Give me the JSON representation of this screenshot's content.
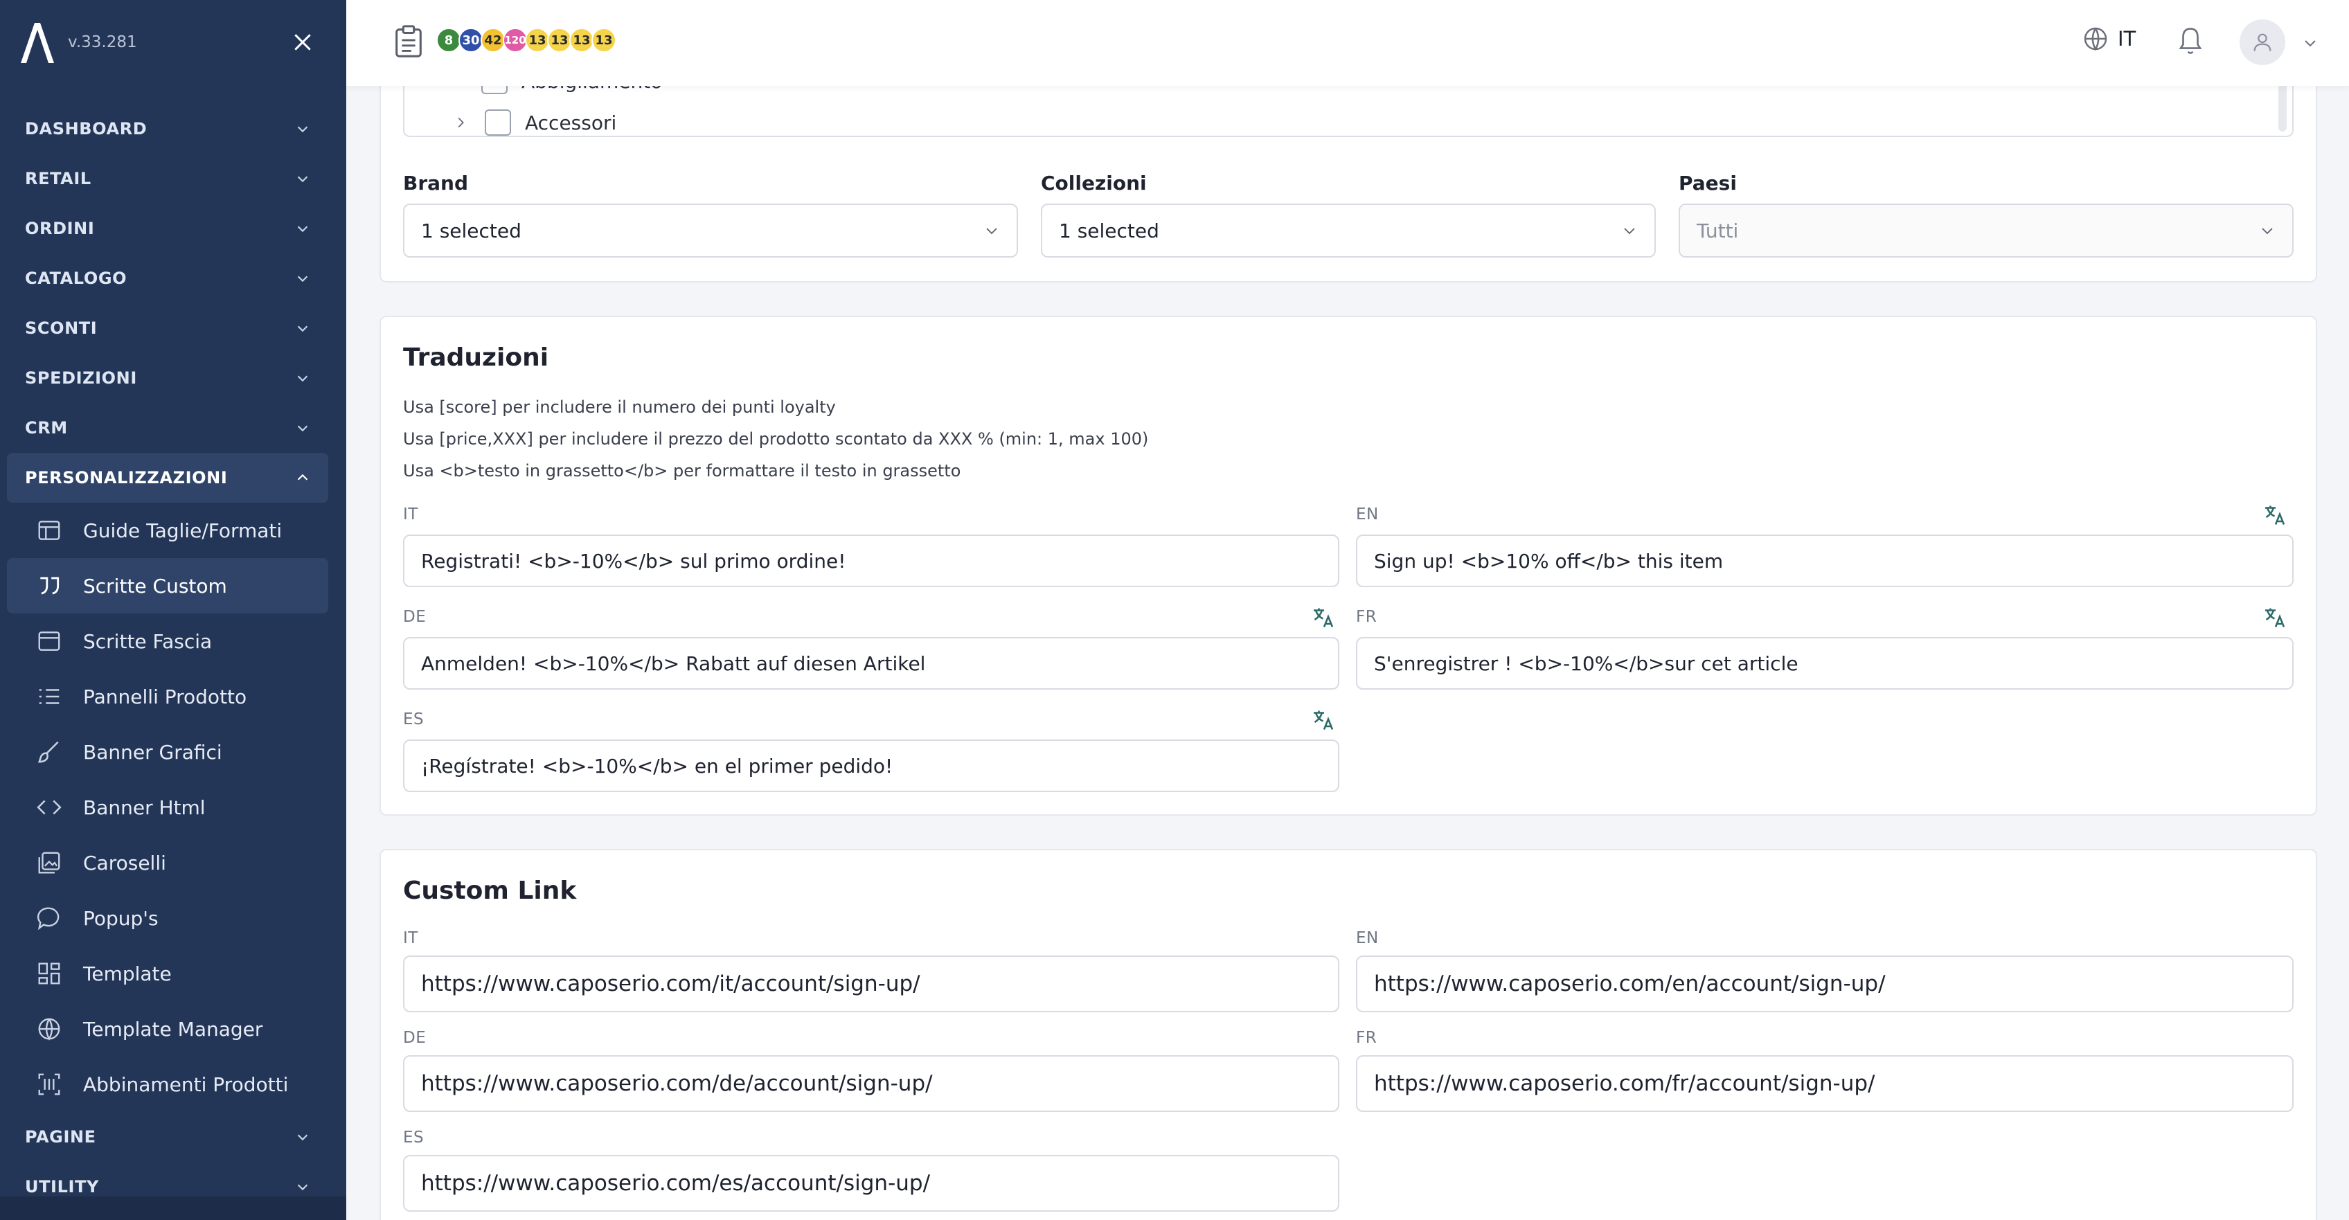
{
  "app": {
    "version": "v.33.281"
  },
  "sidebar": {
    "groups_top": [
      {
        "label": "DASHBOARD"
      },
      {
        "label": "RETAIL"
      },
      {
        "label": "ORDINI"
      },
      {
        "label": "CATALOGO"
      },
      {
        "label": "SCONTI"
      },
      {
        "label": "SPEDIZIONI"
      },
      {
        "label": "CRM"
      }
    ],
    "open_group": {
      "label": "PERSONALIZZAZIONI"
    },
    "sub_items": [
      {
        "label": "Guide Taglie/Formati",
        "icon": "table-icon"
      },
      {
        "label": "Scritte Custom",
        "icon": "quote-icon"
      },
      {
        "label": "Scritte Fascia",
        "icon": "banner-strip-icon"
      },
      {
        "label": "Pannelli Prodotto",
        "icon": "list-icon"
      },
      {
        "label": "Banner Grafici",
        "icon": "brush-icon"
      },
      {
        "label": "Banner Html",
        "icon": "code-icon"
      },
      {
        "label": "Caroselli",
        "icon": "images-icon"
      },
      {
        "label": "Popup's",
        "icon": "chat-bubble-icon"
      },
      {
        "label": "Template",
        "icon": "grid-icon"
      },
      {
        "label": "Template Manager",
        "icon": "globe-icon"
      },
      {
        "label": "Abbinamenti Prodotti",
        "icon": "scan-icon"
      }
    ],
    "groups_bottom": [
      {
        "label": "PAGINE"
      },
      {
        "label": "UTILITY"
      }
    ]
  },
  "topbar": {
    "badges": [
      {
        "value": "8",
        "color": "#3c8a3e"
      },
      {
        "value": "30",
        "color": "#2f4fa8"
      },
      {
        "value": "42",
        "color": "#f2c230"
      },
      {
        "value": "120",
        "color": "#e05aa6"
      },
      {
        "value": "13",
        "color": "#f6d44a"
      },
      {
        "value": "13",
        "color": "#f6d44a"
      },
      {
        "value": "13",
        "color": "#f6d44a"
      },
      {
        "value": "13",
        "color": "#f6d44a"
      }
    ],
    "language": "IT"
  },
  "tree": {
    "items": [
      {
        "label": "Abbigliamento"
      },
      {
        "label": "Accessori"
      }
    ]
  },
  "filters": {
    "brand": {
      "label": "Brand",
      "value": "1 selected"
    },
    "collezioni": {
      "label": "Collezioni",
      "value": "1 selected"
    },
    "paesi": {
      "label": "Paesi",
      "value": "Tutti"
    }
  },
  "translations": {
    "title": "Traduzioni",
    "hints": [
      "Usa [score] per includere il numero dei punti loyalty",
      "Usa [price,XXX] per includere il prezzo del prodotto scontato da XXX % (min: 1, max 100)",
      "Usa <b>testo in grassetto</b> per formattare il testo in grassetto"
    ],
    "fields": {
      "it": {
        "lang": "IT",
        "value": "Registrati! <b>-10%</b> sul primo ordine!"
      },
      "en": {
        "lang": "EN",
        "value": "Sign up! <b>10% off</b> this item"
      },
      "de": {
        "lang": "DE",
        "value": "Anmelden! <b>-10%</b> Rabatt auf diesen Artikel"
      },
      "fr": {
        "lang": "FR",
        "value": "S'enregistrer ! <b>-10%</b>sur cet article"
      },
      "es": {
        "lang": "ES",
        "value": "¡Regístrate! <b>-10%</b> en el primer pedido!"
      }
    }
  },
  "custom_link": {
    "title": "Custom Link",
    "fields": {
      "it": {
        "lang": "IT",
        "value": "https://www.caposerio.com/it/account/sign-up/"
      },
      "en": {
        "lang": "EN",
        "value": "https://www.caposerio.com/en/account/sign-up/"
      },
      "de": {
        "lang": "DE",
        "value": "https://www.caposerio.com/de/account/sign-up/"
      },
      "fr": {
        "lang": "FR",
        "value": "https://www.caposerio.com/fr/account/sign-up/"
      },
      "es": {
        "lang": "ES",
        "value": "https://www.caposerio.com/es/account/sign-up/"
      }
    }
  }
}
